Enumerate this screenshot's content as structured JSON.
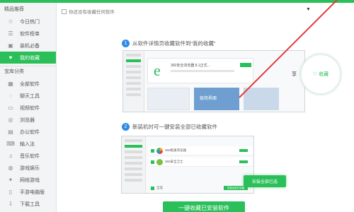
{
  "sidebar": {
    "section1_title": "精品推荐",
    "section1_items": [
      {
        "icon": "star-icon",
        "glyph": "☆",
        "label": "今日热门",
        "active": false
      },
      {
        "icon": "list-icon",
        "glyph": "☰",
        "label": "软件榜单",
        "active": false
      },
      {
        "icon": "save-icon",
        "glyph": "▣",
        "label": "装机必备",
        "active": false
      },
      {
        "icon": "heart-icon",
        "glyph": "♥",
        "label": "我的收藏",
        "active": true
      }
    ],
    "section2_title": "宝库分类",
    "section2_items": [
      {
        "icon": "grid-icon",
        "glyph": "▦",
        "label": "全部软件"
      },
      {
        "icon": "chat-icon",
        "glyph": "◌",
        "label": "聊天工具"
      },
      {
        "icon": "video-icon",
        "glyph": "▭",
        "label": "视频软件"
      },
      {
        "icon": "globe-icon",
        "glyph": "◎",
        "label": "浏览器"
      },
      {
        "icon": "office-icon",
        "glyph": "▤",
        "label": "办公软件"
      },
      {
        "icon": "keyboard-icon",
        "glyph": "⌨",
        "label": "输入法"
      },
      {
        "icon": "music-icon",
        "glyph": "♫",
        "label": "音乐软件"
      },
      {
        "icon": "gamepad-icon",
        "glyph": "◍",
        "label": "游戏娱乐"
      },
      {
        "icon": "puzzle-icon",
        "glyph": "✦",
        "label": "网络游戏"
      },
      {
        "icon": "phone-icon",
        "glyph": "▯",
        "label": "手游电脑版"
      },
      {
        "icon": "download-icon",
        "glyph": "⇩",
        "label": "下载工具"
      }
    ]
  },
  "main": {
    "notice": "你还没有收藏任何软件",
    "dropdown_glyph": "▼",
    "step1": {
      "num": "1",
      "text": "从软件详情页收藏软件到“我的收藏”"
    },
    "step2": {
      "num": "2",
      "text": "新装机时可一键安装全部已收藏软件"
    },
    "illus1": {
      "logo_glyph": "e",
      "app_title": "360安全浏览器 8.1正式...",
      "thumb_label": "极简界面",
      "fav_partial": "享",
      "fav_button": "收藏"
    },
    "illus2": {
      "rows": [
        {
          "name": "360极速浏览器",
          "color": "#f0a23a"
        },
        {
          "name": "360安全卫士",
          "color": "#7bc043"
        }
      ],
      "footer_label": "全选",
      "footer_button": "安装全部已收藏"
    },
    "install_callout": "安装全部已选",
    "main_button": "一键收藏已安装软件"
  },
  "colors": {
    "accent": "#2bbf5a",
    "step_badge": "#2e8ce6",
    "annotation_line": "#e5393a"
  }
}
